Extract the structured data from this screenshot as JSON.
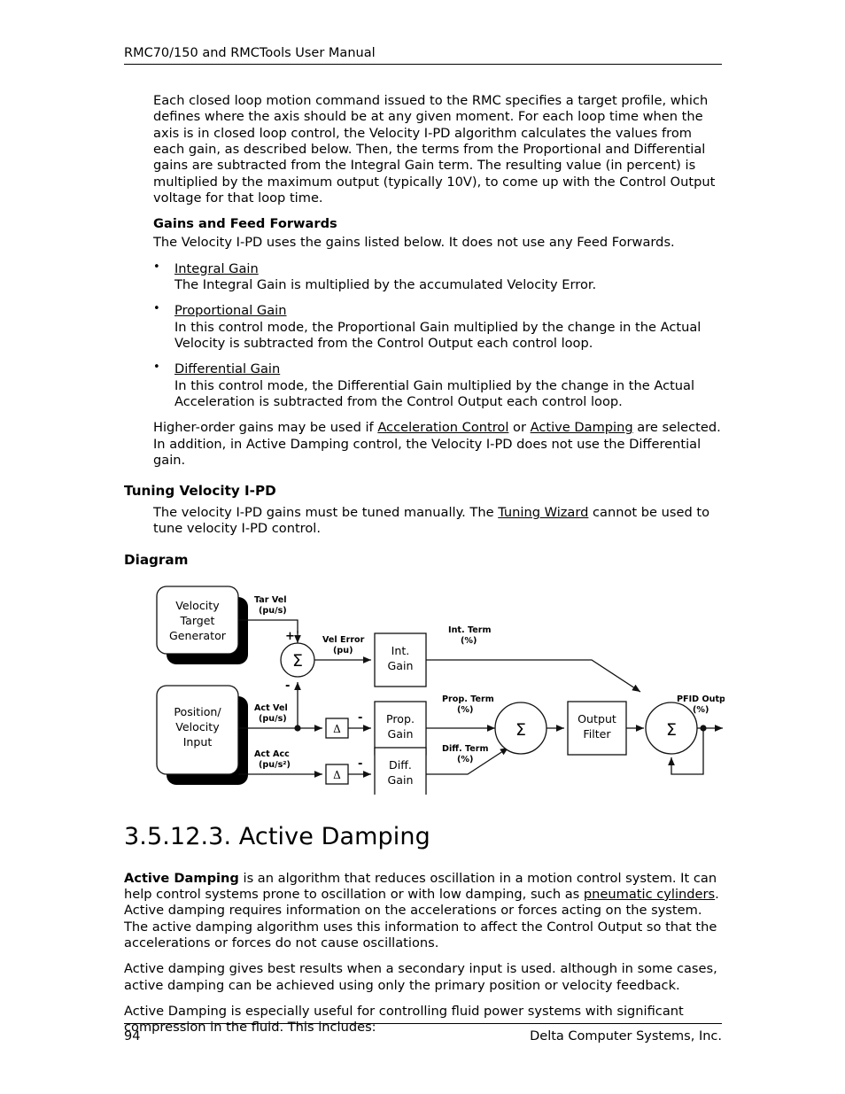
{
  "header": {
    "title": "RMC70/150 and RMCTools User Manual"
  },
  "intro": {
    "paragraph": "Each closed loop motion command issued to the RMC specifies a target profile, which defines where the axis should be at any given moment. For each loop time when the axis is in closed loop control, the Velocity I-PD algorithm calculates the values from each gain, as described below. Then, the terms from the Proportional and Differential gains are subtracted from the Integral Gain term. The resulting value (in percent) is multiplied by the maximum output (typically 10V), to come up with the Control Output voltage for that loop time."
  },
  "gains_section": {
    "heading": "Gains and Feed Forwards",
    "lead": "The Velocity I-PD uses the gains listed below. It does not use any Feed Forwards.",
    "bullets": [
      {
        "term": "Integral Gain",
        "description": "The Integral Gain is multiplied by the accumulated Velocity Error."
      },
      {
        "term": "Proportional Gain",
        "description": "In this control mode, the Proportional Gain multiplied by the change in the Actual Velocity is subtracted from the Control Output each control loop."
      },
      {
        "term": "Differential Gain",
        "description": "In this control mode, the Differential Gain multiplied by the change in the Actual Acceleration is subtracted from the Control Output each control loop."
      }
    ],
    "closing_pre": "Higher-order gains may be used if ",
    "closing_link1": "Acceleration Control",
    "closing_mid": " or ",
    "closing_link2": "Active Damping",
    "closing_post": " are selected. In addition, in Active Damping control, the Velocity I-PD does not use the Differential gain."
  },
  "tuning_section": {
    "heading": "Tuning Velocity I-PD",
    "body_pre": "The velocity I-PD gains must be tuned manually. The ",
    "body_link": "Tuning Wizard",
    "body_post": " cannot be used to tune velocity I-PD control."
  },
  "diagram_section": {
    "heading": "Diagram",
    "blocks": {
      "velocity_target_generator": [
        "Velocity",
        "Target",
        "Generator"
      ],
      "position_velocity_input": [
        "Position/",
        "Velocity",
        "Input"
      ],
      "int_gain": [
        "Int.",
        "Gain"
      ],
      "prop_gain": [
        "Prop.",
        "Gain"
      ],
      "diff_gain": [
        "Diff.",
        "Gain"
      ],
      "output_filter": [
        "Output",
        "Filter"
      ],
      "delta_symbol": "Δ",
      "sigma_symbol": "Σ"
    },
    "signals": {
      "tar_vel": [
        "Tar Vel",
        "(pu/s)"
      ],
      "act_vel": [
        "Act Vel",
        "(pu/s)"
      ],
      "act_acc": [
        "Act Acc",
        "(pu/s²)"
      ],
      "vel_error": [
        "Vel Error",
        "(pu)"
      ],
      "int_term": [
        "Int. Term",
        "(%)"
      ],
      "prop_term": [
        "Prop. Term",
        "(%)"
      ],
      "diff_term": [
        "Diff. Term",
        "(%)"
      ],
      "pfid_output": [
        "PFID Output",
        "(%)"
      ]
    },
    "signs": {
      "plus": "+",
      "minus": "-"
    }
  },
  "active_damping": {
    "title": "3.5.12.3. Active Damping",
    "p1_bold": "Active Damping",
    "p1_pre": " is an algorithm that reduces oscillation in a motion control system. It can help control systems prone to oscillation or with low damping, such as ",
    "p1_link": "pneumatic cylinders",
    "p1_post": ". Active damping requires information on the accelerations or forces acting on the system. The active damping algorithm uses this information to affect the Control Output so that the accelerations or forces do not cause oscillations.",
    "p2": "Active damping gives best results when a secondary input is used. although in some cases, active damping can be achieved using only the primary position or velocity feedback.",
    "p3": "Active Damping is especially useful for controlling fluid power systems with significant compression in the fluid. This includes:"
  },
  "footer": {
    "page_number": "94",
    "company": "Delta Computer Systems, Inc."
  },
  "colors": {
    "text": "#000000",
    "rule": "#000000",
    "page_background": "#ffffff",
    "diagram_shadow": "#000000",
    "diagram_stroke": "#1a1a1a"
  }
}
